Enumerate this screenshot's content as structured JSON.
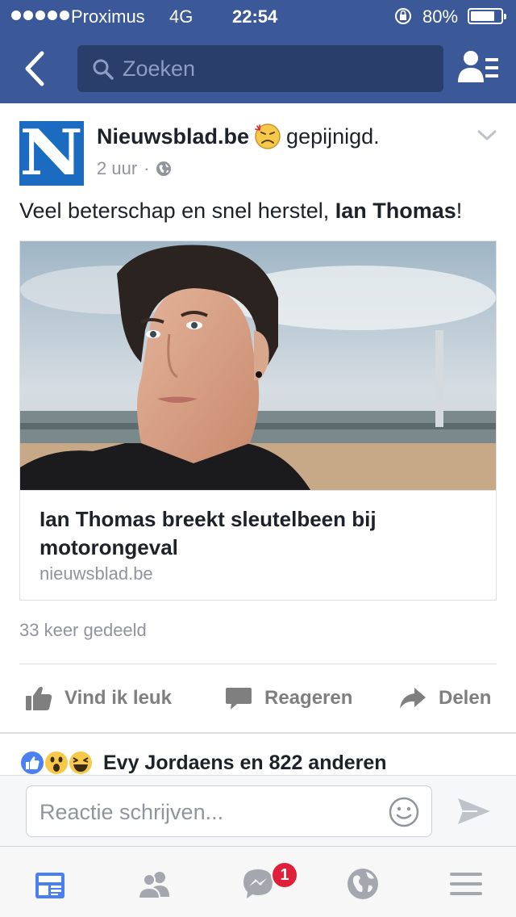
{
  "status_bar": {
    "carrier": "Proximus",
    "network": "4G",
    "time": "22:54",
    "battery": "80%",
    "battery_level": 0.8
  },
  "nav": {
    "search_placeholder": "Zoeken",
    "back_icon": "chevron-left-icon",
    "friends_icon": "friend-requests-icon"
  },
  "post": {
    "page_name": "Nieuwsblad.be",
    "page_logo_letter": "N",
    "feeling_emoji": "pained-face-emoji",
    "feeling": "gepijnigd.",
    "time_ago": "2 uur",
    "separator": "·",
    "privacy_icon": "globe-icon",
    "text_prefix": "Veel beterschap en snel herstel, ",
    "text_mention": "Ian Thomas",
    "text_suffix": "!",
    "link": {
      "title": "Ian Thomas breekt sleutelbeen bij motorongeval",
      "domain": "nieuwsblad.be"
    },
    "share_count": "33 keer gedeeld",
    "actions": {
      "like": "Vind ik leuk",
      "comment": "Reageren",
      "share": "Delen"
    }
  },
  "reactions": {
    "icons": [
      "like-icon",
      "wow-icon",
      "haha-icon"
    ],
    "summary": "Evy Jordaens en 822 anderen"
  },
  "composer": {
    "placeholder": "Reactie schrijven...",
    "sticker_icon": "smiley-icon",
    "send_icon": "send-icon"
  },
  "tabbar": {
    "tabs": [
      "news-feed-icon",
      "friends-icon",
      "messenger-icon",
      "globe-notifications-icon",
      "menu-icon"
    ],
    "messenger_badge": "1"
  },
  "colors": {
    "brand": "#3b5998",
    "nieuwsblad": "#1b6cc1",
    "badge": "#e0203a"
  }
}
